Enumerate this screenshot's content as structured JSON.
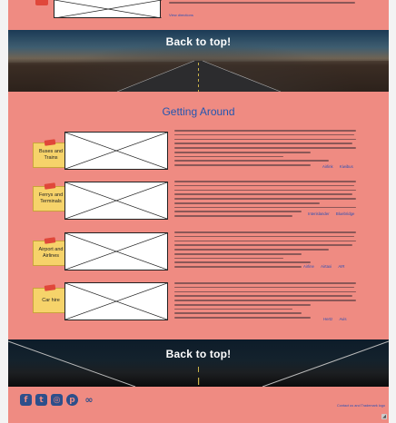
{
  "top_more_link": "View directions",
  "back_to_top": "Back to top!",
  "main_title": "Getting Around",
  "rows": [
    {
      "label": "Buses and Trains",
      "links": [
        "Airlink",
        "Kiwibus"
      ]
    },
    {
      "label": "Ferrys and Terminals",
      "links": [
        "Interislander",
        "Bluebridge"
      ]
    },
    {
      "label": "Airport and Airlines",
      "links": [
        "Airline",
        "Airtaxi",
        "AIR"
      ]
    },
    {
      "label": "Car hire",
      "links": [
        "Hertz",
        "Avis"
      ]
    }
  ],
  "footer_contact": "Contact us and Trademark logo",
  "social_icons": [
    "facebook-icon",
    "twitter-icon",
    "instagram-icon",
    "pinterest-icon",
    "tripadvisor-icon"
  ],
  "colors": {
    "background": "#ef8b82",
    "link": "#2a4fb5",
    "title": "#2356b0",
    "note": "#f6d36a",
    "pin": "#e0473a"
  }
}
